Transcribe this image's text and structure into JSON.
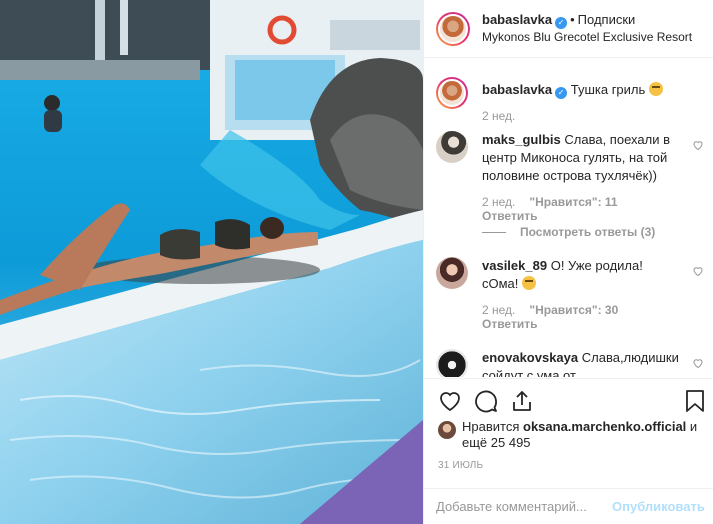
{
  "post": {
    "author": "babaslavka",
    "follow_label": "Подписки",
    "location": "Mykonos Blu Grecotel Exclusive Resort"
  },
  "caption": {
    "author": "babaslavka",
    "text": "Тушка гриль",
    "time": "2 нед."
  },
  "comments": [
    {
      "user": "maks_gulbis",
      "text": "Слава, поехали в центр Миконоса гулять, на той половине острова тухлячёк))",
      "time": "2 нед.",
      "likes": "\"Нравится\": 11",
      "reply": "Ответить",
      "view_replies": "Посмотреть ответы (3)"
    },
    {
      "user": "vasilek_89",
      "text": "О! Уже родила! сОма!",
      "time": "2 нед.",
      "likes": "\"Нравится\": 30",
      "reply": "Ответить"
    },
    {
      "user": "enovakovskaya",
      "text": "Слава,людишки сойдут с ума от",
      "time": "",
      "likes": "",
      "reply": ""
    }
  ],
  "likes_line": {
    "prefix": "Нравится",
    "user": "oksana.marchenko.official",
    "suffix": "и ещё 25 495"
  },
  "date": "31 ИЮЛЬ",
  "add_comment": {
    "placeholder": "Добавьте комментарий...",
    "publish_label": "Опубликовать"
  },
  "colors": {
    "accent_blue": "#3897f0",
    "publish_disabled": "#b2dffc",
    "muted": "#999999",
    "text": "#262626"
  },
  "icons": [
    "verified-icon",
    "heart-icon",
    "comment-icon",
    "share-icon",
    "bookmark-icon",
    "small-heart-icon",
    "emoji-icon"
  ]
}
